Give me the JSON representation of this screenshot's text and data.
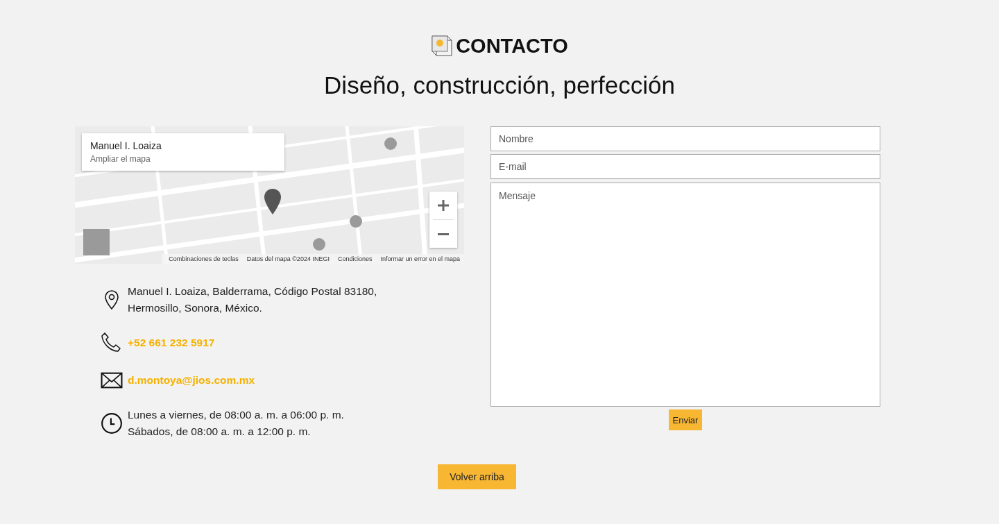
{
  "header": {
    "title": "CONTACTO",
    "subtitle": "Diseño, construcción, perfección"
  },
  "map": {
    "kind": "picture",
    "place_card": {
      "title": "Manuel I. Loaiza",
      "link": "Ampliar el mapa"
    },
    "footer_links": [
      "Combinaciones de teclas",
      "Datos del mapa ©2024 INEGI",
      "Condiciones",
      "Informar un error en el mapa"
    ]
  },
  "contact_items": [
    {
      "kind": "address",
      "lines": [
        "Manuel I. Loaiza, Balderrama, Código Postal 83180,",
        "Hermosillo, Sonora, México."
      ]
    },
    {
      "kind": "phone",
      "lines": [
        "+52 661 232 5917"
      ]
    },
    {
      "kind": "email",
      "lines": [
        "d.montoya@jios.com.mx"
      ]
    },
    {
      "kind": "hours",
      "lines": [
        "Lunes a viernes, de 08:00 a. m. a 06:00 p. m.",
        "Sábados, de 08:00 a. m. a 12:00 p. m."
      ]
    }
  ],
  "form": {
    "fields": [
      {
        "kind": "input",
        "placeholder": "Nombre"
      },
      {
        "kind": "input",
        "placeholder": "E-mail"
      },
      {
        "kind": "textarea",
        "placeholder": "Mensaje"
      }
    ],
    "submit": "Enviar"
  },
  "back_to_top": "Volver arriba"
}
